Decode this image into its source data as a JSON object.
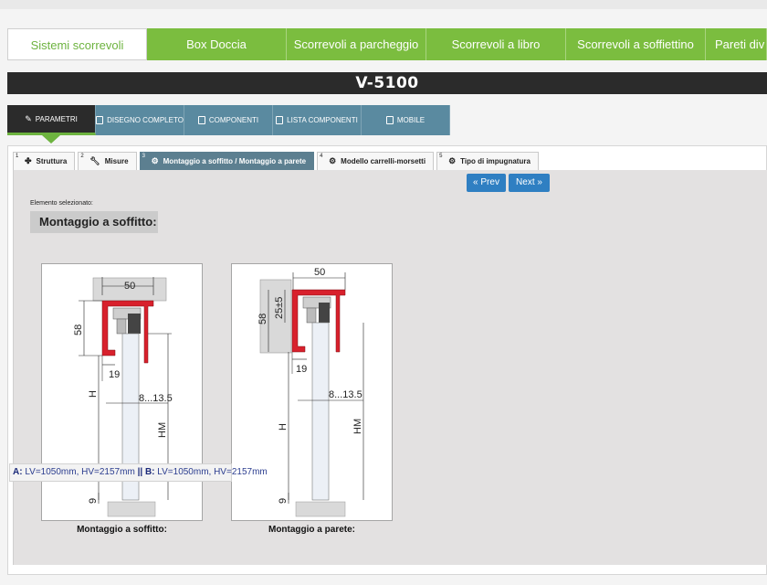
{
  "categories": [
    {
      "label": "Sistemi scorrevoli",
      "active": true
    },
    {
      "label": "Box Doccia",
      "active": false
    },
    {
      "label": "Scorrevoli a parcheggio",
      "active": false
    },
    {
      "label": "Scorrevoli a libro",
      "active": false
    },
    {
      "label": "Scorrevoli a soffiettino",
      "active": false
    },
    {
      "label": "Pareti div",
      "active": false
    }
  ],
  "product": {
    "title": "V-5100"
  },
  "tool_tabs": [
    {
      "label": "Parametri",
      "icon": "edit-icon",
      "active": true
    },
    {
      "label": "Disegno completo",
      "icon": "document-icon",
      "active": false
    },
    {
      "label": "Componenti",
      "icon": "document-icon",
      "active": false
    },
    {
      "label": "Lista componenti",
      "icon": "document-icon",
      "active": false
    },
    {
      "label": "Mobile",
      "icon": "document-icon",
      "active": false
    }
  ],
  "steps": [
    {
      "num": "1",
      "label": "Struttura",
      "icon": "structure-icon"
    },
    {
      "num": "2",
      "label": "Misure",
      "icon": "wrench-icon"
    },
    {
      "num": "3",
      "label": "Montaggio a soffitto / Montaggio a parete",
      "icon": "gear-icon",
      "active": true
    },
    {
      "num": "4",
      "label": "Modello carrelli-morsetti",
      "icon": "gear-icon"
    },
    {
      "num": "5",
      "label": "Tipo di impugnatura",
      "icon": "gear-icon"
    }
  ],
  "nav": {
    "prev": "« Prev",
    "next": "Next »"
  },
  "selected": {
    "label": "Elemento selezionato:",
    "value": "Montaggio a soffitto:"
  },
  "figures": [
    {
      "caption": "Montaggio a soffitto:",
      "dims": {
        "width": "50",
        "height_top": "58",
        "offset": "19",
        "gap": "8...13.5",
        "h": "H",
        "hm": "HM",
        "bottom": "9"
      }
    },
    {
      "caption": "Montaggio a parete:",
      "dims": {
        "width": "50",
        "height_top": "58",
        "tol": "25±5",
        "offset": "19",
        "gap": "8...13.5",
        "h": "H",
        "hm": "HM",
        "bottom": "9"
      }
    }
  ],
  "tooltip": {
    "a_label": "A:",
    "a_value": "LV=1050mm, HV=2157mm",
    "sep": "||",
    "b_label": "B:",
    "b_value": "LV=1050mm, HV=2157mm"
  },
  "colors": {
    "green": "#7bbd3f",
    "profile_red": "#d8202c",
    "tab_blue": "#5a8aa0",
    "button_blue": "#2f7fc2"
  }
}
